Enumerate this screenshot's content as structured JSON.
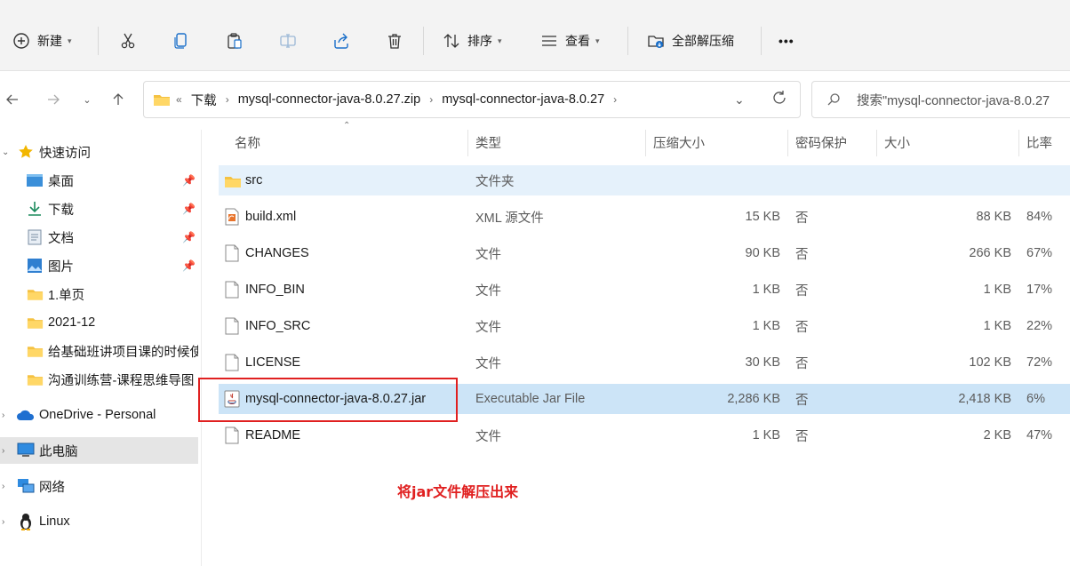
{
  "toolbar": {
    "new_label": "新建",
    "sort_label": "排序",
    "view_label": "查看",
    "extract_all_label": "全部解压缩",
    "more_label": "•••"
  },
  "address": {
    "overflow": "«",
    "crumbs": [
      "下载",
      "mysql-connector-java-8.0.27.zip",
      "mysql-connector-java-8.0.27"
    ]
  },
  "search": {
    "placeholder": "搜索\"mysql-connector-java-8.0.27"
  },
  "sidebar": {
    "quick_access": "快速访问",
    "items": [
      {
        "label": "桌面"
      },
      {
        "label": "下载"
      },
      {
        "label": "文档"
      },
      {
        "label": "图片"
      },
      {
        "label": "1.单页"
      },
      {
        "label": "2021-12"
      },
      {
        "label": "给基础班讲项目课的时候使"
      },
      {
        "label": "沟通训练营-课程思维导图"
      }
    ],
    "onedrive": "OneDrive - Personal",
    "this_pc": "此电脑",
    "network": "网络",
    "linux": "Linux"
  },
  "columns": {
    "name": "名称",
    "type": "类型",
    "compressed": "压缩大小",
    "password": "密码保护",
    "size": "大小",
    "ratio": "比率"
  },
  "files": [
    {
      "name": "src",
      "type": "文件夹",
      "compressed": "",
      "password": "",
      "size": "",
      "ratio": ""
    },
    {
      "name": "build.xml",
      "type": "XML 源文件",
      "compressed": "15 KB",
      "password": "否",
      "size": "88 KB",
      "ratio": "84%"
    },
    {
      "name": "CHANGES",
      "type": "文件",
      "compressed": "90 KB",
      "password": "否",
      "size": "266 KB",
      "ratio": "67%"
    },
    {
      "name": "INFO_BIN",
      "type": "文件",
      "compressed": "1 KB",
      "password": "否",
      "size": "1 KB",
      "ratio": "17%"
    },
    {
      "name": "INFO_SRC",
      "type": "文件",
      "compressed": "1 KB",
      "password": "否",
      "size": "1 KB",
      "ratio": "22%"
    },
    {
      "name": "LICENSE",
      "type": "文件",
      "compressed": "30 KB",
      "password": "否",
      "size": "102 KB",
      "ratio": "72%"
    },
    {
      "name": "mysql-connector-java-8.0.27.jar",
      "type": "Executable Jar File",
      "compressed": "2,286 KB",
      "password": "否",
      "size": "2,418 KB",
      "ratio": "6%"
    },
    {
      "name": "README",
      "type": "文件",
      "compressed": "1 KB",
      "password": "否",
      "size": "2 KB",
      "ratio": "47%"
    }
  ],
  "annotation": "将jar文件解压出来",
  "colors": {
    "accent_select": "#cce4f7",
    "hover_row": "#e5f1fb",
    "annotation": "#e02020",
    "folder": "#f5c242"
  }
}
